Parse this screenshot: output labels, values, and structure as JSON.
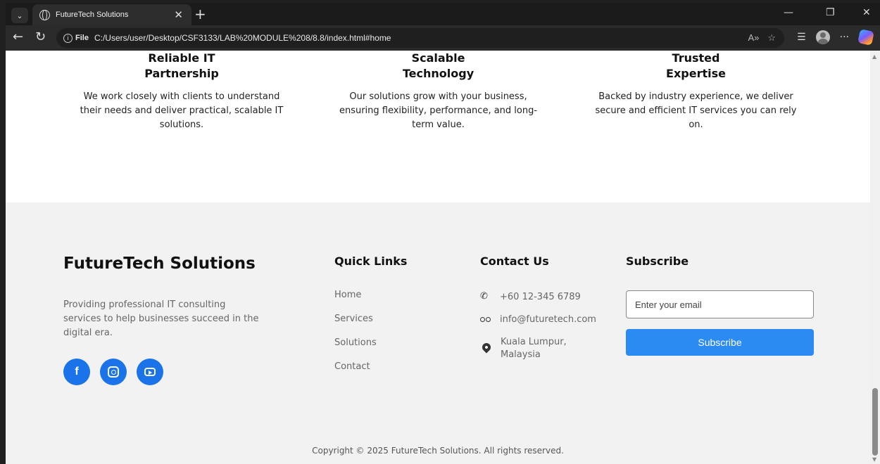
{
  "browser": {
    "tab_title": "FutureTech Solutions",
    "tab_close": "✕",
    "new_tab": "+",
    "window_minimize": "—",
    "window_restore": "❐",
    "window_close": "✕",
    "address_prefix": "File",
    "url": "C:/Users/user/Desktop/CSF3133/LAB%20MODULE%208/8.8/index.html#home",
    "icons": [
      "back-icon",
      "refresh-icon",
      "read-aloud-icon",
      "favorite-icon",
      "favorites-list-icon",
      "profile-icon",
      "more-icon",
      "copilot-icon"
    ]
  },
  "features": [
    {
      "title_line1": "Reliable IT",
      "title_line2": "Partnership",
      "text": "We work closely with clients to understand their needs and deliver practical, scalable IT solutions."
    },
    {
      "title_line1": "Scalable",
      "title_line2": "Technology",
      "text": "Our solutions grow with your business, ensuring flexibility, performance, and long-term value."
    },
    {
      "title_line1": "Trusted",
      "title_line2": "Expertise",
      "text": "Backed by industry experience, we deliver secure and efficient IT services you can rely on."
    }
  ],
  "footer": {
    "brand": "FutureTech Solutions",
    "description": "Providing professional IT consulting services to help businesses succeed in the digital era.",
    "socials": [
      "facebook-icon",
      "instagram-icon",
      "youtube-icon"
    ],
    "facebook_glyph": "f",
    "quick_links_title": "Quick Links",
    "quick_links": [
      "Home",
      "Services",
      "Solutions",
      "Contact"
    ],
    "contact_title": "Contact Us",
    "phone": "+60 12-345 6789",
    "email": "info@futuretech.com",
    "location": "Kuala Lumpur, Malaysia",
    "subscribe_title": "Subscribe",
    "email_placeholder": "Enter your email",
    "subscribe_button": "Subscribe",
    "copyright": "Copyright © 2025 FutureTech Solutions. All rights reserved."
  },
  "colors": {
    "accent": "#2b8bf2",
    "social": "#1a73e8",
    "footer_bg": "#f2f2f2"
  }
}
